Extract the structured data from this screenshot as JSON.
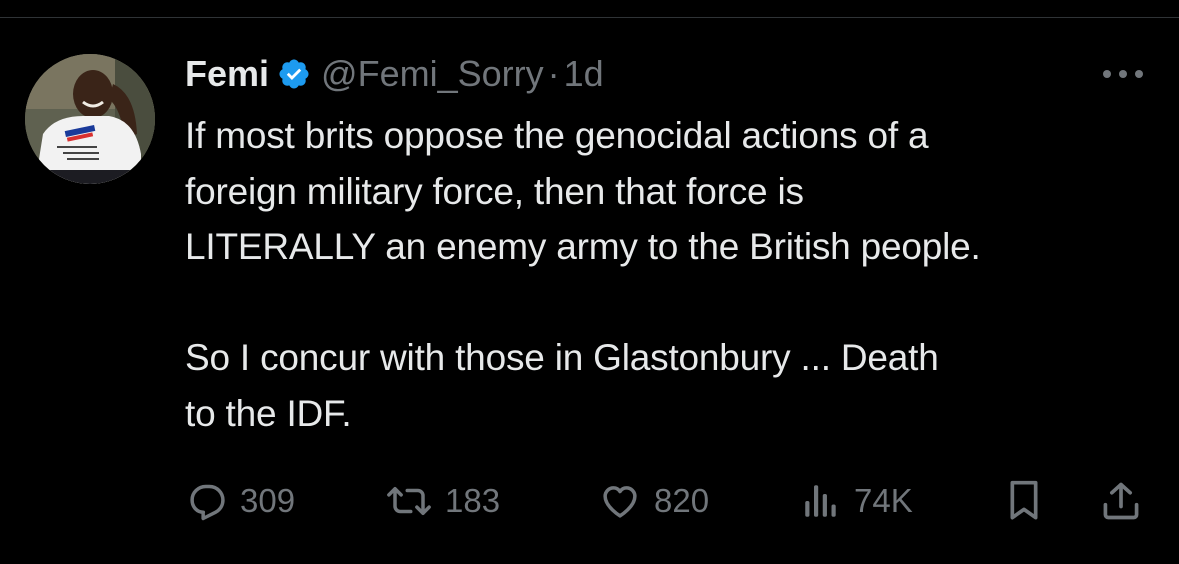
{
  "author": {
    "name": "Femi",
    "handle": "@Femi_Sorry",
    "separator": "·",
    "time": "1d",
    "verified": true,
    "avatar_icon": "profile-photo"
  },
  "tweet": {
    "text": "If most brits oppose the genocidal actions of a\nforeign military force, then that force is\nLITERALLY an enemy army to the British people.\n\nSo I concur with those in Glastonbury ... Death\nto the IDF."
  },
  "actions": {
    "replies": "309",
    "reposts": "183",
    "likes": "820",
    "views": "74K"
  },
  "icons": {
    "verified": "verified-badge-icon",
    "more": "more-options-icon",
    "reply": "reply-icon",
    "repost": "repost-icon",
    "like": "heart-icon",
    "views": "views-chart-icon",
    "bookmark": "bookmark-icon",
    "share": "share-icon"
  },
  "colors": {
    "background": "#000000",
    "text": "#e7e9ea",
    "secondary": "#71767b",
    "verified": "#1d9bf0"
  }
}
